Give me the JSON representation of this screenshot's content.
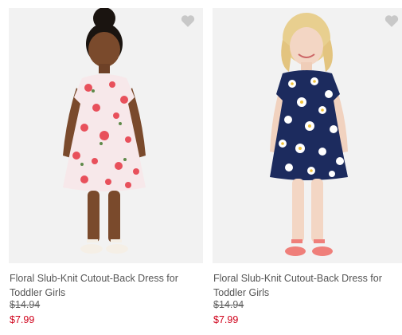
{
  "products": [
    {
      "title": "Floral Slub-Knit Cutout-Back Dress for Toddler Girls",
      "original_price": "$14.94",
      "sale_price": "$7.99",
      "image": "toddler-girl-pink-floral-dress-photo",
      "favorite_icon": "heart-icon",
      "dress_color": "#f7e8ea",
      "flower_color": "#e8505b"
    },
    {
      "title": "Floral Slub-Knit Cutout-Back Dress for Toddler Girls",
      "original_price": "$14.94",
      "sale_price": "$7.99",
      "image": "toddler-girl-navy-daisy-dress-photo",
      "favorite_icon": "heart-icon",
      "dress_color": "#1c2b5e",
      "flower_color": "#ffffff"
    }
  ],
  "colors": {
    "sale_price": "#d0021b",
    "heart": "#c8c8c8",
    "photo_bg": "#f2f2f2"
  }
}
